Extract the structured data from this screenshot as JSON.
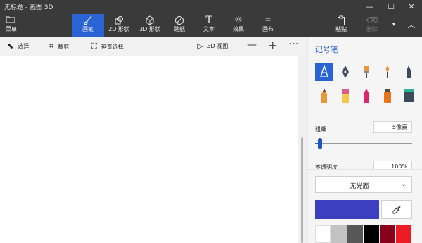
{
  "window": {
    "title": "无标题 - 画图 3D",
    "controls": [
      "minimize-icon",
      "maximize-icon",
      "close-icon"
    ]
  },
  "ribbon": {
    "menu_label": "菜单",
    "tabs": [
      {
        "label": "画笔",
        "icon": "brush-icon",
        "active": true
      },
      {
        "label": "2D 形状",
        "icon": "shapes-2d-icon"
      },
      {
        "label": "3D 形状",
        "icon": "cube-icon"
      },
      {
        "label": "贴纸",
        "icon": "sticker-icon"
      },
      {
        "label": "文本",
        "icon": "text-icon"
      },
      {
        "label": "效果",
        "icon": "effects-icon"
      },
      {
        "label": "画布",
        "icon": "canvas-icon"
      }
    ],
    "paste_label": "粘贴",
    "delete_label": "删除",
    "more_icon": "chevron-down-icon",
    "collapse_icon": "chevron-up-icon"
  },
  "toolbar": {
    "select_label": "选择",
    "crop_label": "裁剪",
    "magic_select_label": "神奇选择",
    "view_3d_label": "3D 视图",
    "zoom_out_icon": "minus-icon",
    "zoom_in_icon": "plus-icon",
    "more_icon": "ellipsis-icon"
  },
  "panel": {
    "title": "记号笔",
    "brushes_row1": [
      "marker",
      "calligraphy-pen",
      "oil-brush",
      "watercolor",
      "pixel-pen"
    ],
    "brushes_row2": [
      "pencil",
      "eraser",
      "crayon",
      "spray-can",
      "fill"
    ],
    "thickness_label": "粗细",
    "thickness_value": "5像素",
    "opacity_label": "不透明度",
    "opacity_value": "100%",
    "thickness_level": 0.05,
    "finish_value": "无光面",
    "current_color": "#3b3fc0",
    "palette": [
      "#ffffff",
      "#c3c3c3",
      "#585858",
      "#000000",
      "#88001b",
      "#ec1c24"
    ]
  }
}
